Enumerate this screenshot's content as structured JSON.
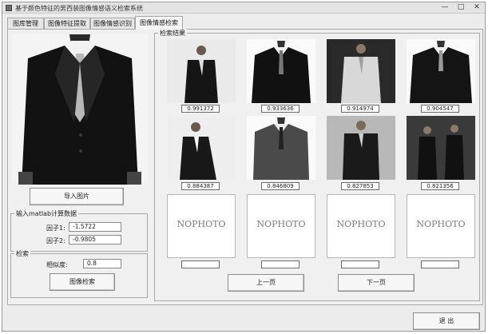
{
  "window": {
    "title": "基于颜色特征的男西装图像情感语义检索系统",
    "minimize_glyph": "—",
    "maximize_glyph": "□",
    "close_glyph": "✕"
  },
  "tabs": [
    {
      "label": "图库管理",
      "active": false
    },
    {
      "label": "图像特征提取",
      "active": false
    },
    {
      "label": "图像情感识别",
      "active": false
    },
    {
      "label": "图像情感检索",
      "active": true
    }
  ],
  "left_panel": {
    "import_button": "导入图片",
    "matlab_group": {
      "legend": "输入matlab计算数据",
      "factor1_label": "因子1:",
      "factor1_value": "-1.5722",
      "factor2_label": "因子2:",
      "factor2_value": "-0.9805"
    },
    "search_group": {
      "legend": "检索",
      "similarity_label": "相似度:",
      "similarity_value": "0.8",
      "search_button": "图像检索"
    }
  },
  "results": {
    "legend": "检索结果",
    "items": [
      {
        "score": "0.991372",
        "placeholder": ""
      },
      {
        "score": "0.933636",
        "placeholder": ""
      },
      {
        "score": "0.914974",
        "placeholder": ""
      },
      {
        "score": "0.904547",
        "placeholder": ""
      },
      {
        "score": "0.884387",
        "placeholder": ""
      },
      {
        "score": "0.846809",
        "placeholder": ""
      },
      {
        "score": "0.827853",
        "placeholder": ""
      },
      {
        "score": "0.821356",
        "placeholder": ""
      },
      {
        "score": "",
        "placeholder": "NOPHOTO"
      },
      {
        "score": "",
        "placeholder": "NOPHOTO"
      },
      {
        "score": "",
        "placeholder": "NOPHOTO"
      },
      {
        "score": "",
        "placeholder": "NOPHOTO"
      }
    ],
    "prev_button": "上一页",
    "next_button": "下一页"
  },
  "footer": {
    "exit_button": "退 出"
  }
}
